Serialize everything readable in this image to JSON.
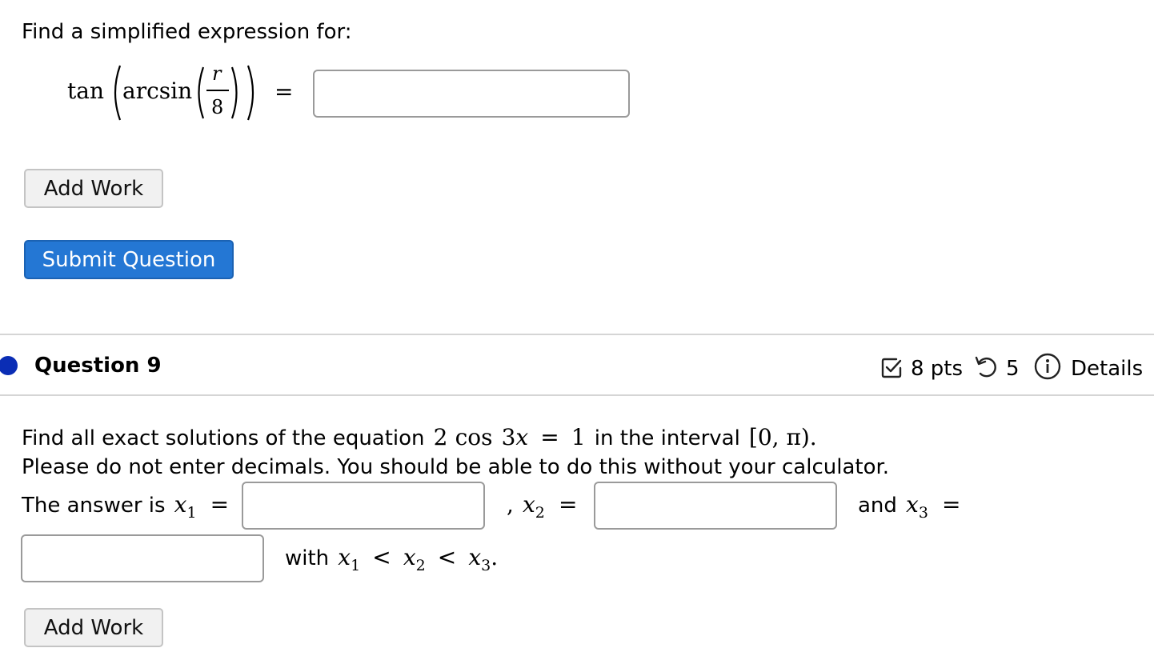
{
  "question8": {
    "prompt": "Find a simplified expression for:",
    "expression": {
      "fn_outer": "tan",
      "fn_inner": "arcsin",
      "numerator": "r",
      "denominator": "8",
      "equals": "="
    },
    "answer": {
      "value": ""
    },
    "add_work_label": "Add Work",
    "submit_label": "Submit Question"
  },
  "question9": {
    "title": "Question 9",
    "meta": {
      "points": "8 pts",
      "attempts": "5",
      "details_label": "Details"
    },
    "line1": {
      "text_before": "Find all exact solutions of the equation",
      "eq_coef": "2",
      "eq_fn": "cos",
      "eq_arg_num": "3",
      "eq_arg_var": "x",
      "eq_equals": "=",
      "eq_rhs": "1",
      "text_mid": "in the interval",
      "interval": "[0, π)."
    },
    "line2": "Please do not enter decimals. You should be able to do this without your calculator.",
    "answer_line": {
      "text_before": "The answer is",
      "x_var": "x",
      "sub1": "1",
      "sub2": "2",
      "sub3": "3",
      "equals": "=",
      "comma": ",",
      "and_text": "and",
      "with_text": "with",
      "less_than": "<",
      "period": "."
    },
    "answers": [
      "",
      "",
      ""
    ],
    "add_work_label": "Add Work"
  },
  "colors": {
    "primary_button": "#2477d4",
    "question_dot": "#0a2db5",
    "input_border": "#9a9a9a"
  },
  "icons": {
    "points": "checkbox-icon",
    "attempts": "retry-icon",
    "details": "info-icon"
  }
}
